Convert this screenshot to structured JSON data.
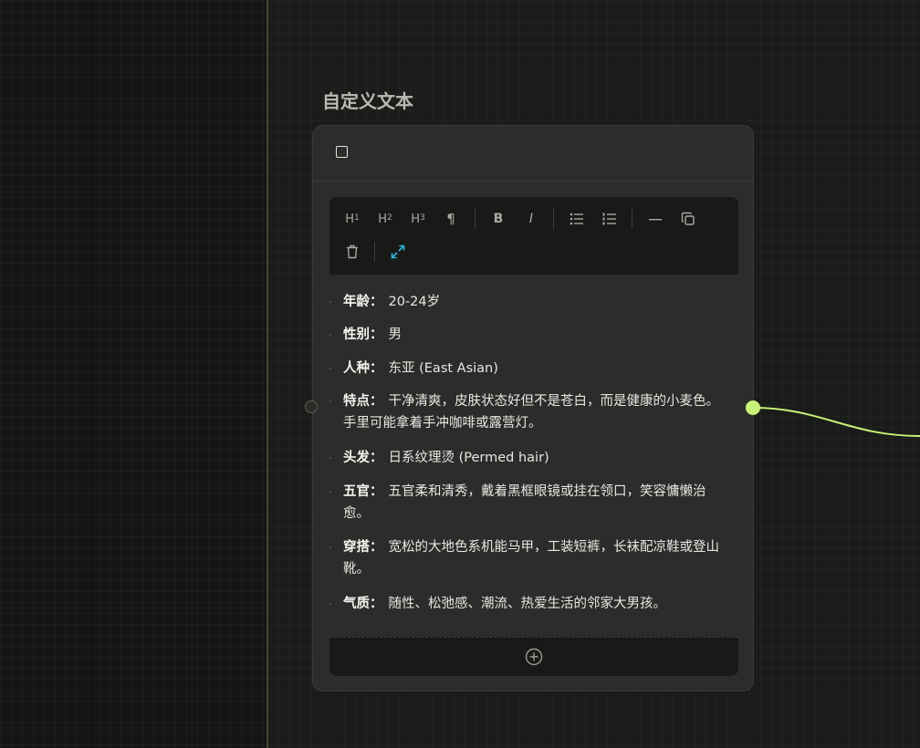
{
  "node": {
    "title": "自定义文本",
    "accent_color": "#c8f27a"
  },
  "toolbar": {
    "items": [
      {
        "name": "heading-1",
        "label": "H",
        "sup": "1"
      },
      {
        "name": "heading-2",
        "label": "H",
        "sup": "2"
      },
      {
        "name": "heading-3",
        "label": "H",
        "sup": "3"
      },
      {
        "name": "paragraph",
        "label": "¶"
      },
      {
        "name": "bold",
        "label": "B"
      },
      {
        "name": "italic",
        "label": "I"
      },
      {
        "name": "bullet-list-icon"
      },
      {
        "name": "ordered-list-icon"
      },
      {
        "name": "horizontal-rule-icon"
      },
      {
        "name": "copy-icon"
      },
      {
        "name": "trash-icon"
      },
      {
        "name": "expand-icon",
        "color": "#2fb7d8"
      }
    ]
  },
  "content": {
    "items": [
      {
        "label": "年龄：",
        "value": "20-24岁"
      },
      {
        "label": "性别：",
        "value": "男"
      },
      {
        "label": "人种：",
        "value": "东亚 (East Asian)"
      },
      {
        "label": "特点：",
        "value": "干净清爽，皮肤状态好但不是苍白，而是健康的小麦色。手里可能拿着手冲咖啡或露营灯。"
      },
      {
        "label": "头发：",
        "value": "日系纹理烫 (Permed hair)"
      },
      {
        "label": "五官：",
        "value": "五官柔和清秀，戴着黑框眼镜或挂在领口，笑容慵懒治愈。"
      },
      {
        "label": "穿搭：",
        "value": "宽松的大地色系机能马甲，工装短裤，长袜配凉鞋或登山靴。"
      },
      {
        "label": "气质：",
        "value": "随性、松弛感、潮流、热爱生活的邻家大男孩。"
      }
    ]
  }
}
